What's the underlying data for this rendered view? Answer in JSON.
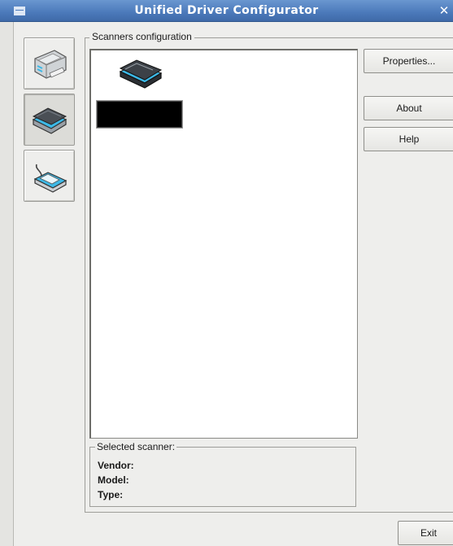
{
  "window": {
    "title": "Unified Driver Configurator",
    "close_glyph": "✕"
  },
  "sidebar": {
    "items": [
      {
        "name": "printers-configuration",
        "icon": "printer-icon",
        "active": false
      },
      {
        "name": "scanners-configuration",
        "icon": "scanner-icon",
        "active": true
      },
      {
        "name": "ports-configuration",
        "icon": "port-icon",
        "active": false
      }
    ]
  },
  "main": {
    "group_title": "Scanners configuration",
    "scanner_list": [
      {
        "icon": "scanner-icon",
        "label": ""
      }
    ],
    "buttons": {
      "properties": "Properties...",
      "about": "About",
      "help": "Help"
    },
    "selected_scanner": {
      "legend": "Selected scanner:",
      "vendor_label": "Vendor:",
      "model_label": "Model:",
      "type_label": "Type:"
    }
  },
  "footer": {
    "exit_label": "Exit"
  },
  "colors": {
    "titlebar": "#4b79ba",
    "window_bg": "#eeeeec",
    "accent_cyan": "#3cb8e6"
  }
}
